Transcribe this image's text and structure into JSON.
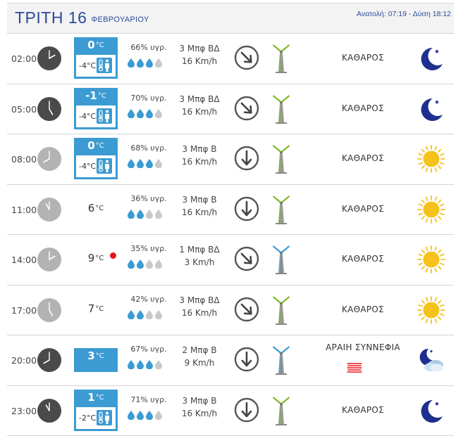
{
  "header": {
    "day": "ΤΡΙΤΗ 16",
    "month": "ΦΕΒΡΟΥΑΡΙΟΥ",
    "sun_times": "Ανατολή: 07:19 - Δύση 18:12"
  },
  "units": {
    "temp": "°C"
  },
  "rows": [
    {
      "time": "02:00",
      "clock_hour": 2,
      "clock_style": "dark",
      "temp": "0",
      "feel": "-4°C",
      "boxed": true,
      "humidity": "66% υγρ.",
      "drops": 3,
      "wind_force": "3 Μπφ ΒΔ",
      "wind_speed": "16 Km/h",
      "wind_dir": "nw",
      "turbine": "green",
      "condition": "ΚΑΘΑΡΟΣ",
      "icon": "moon-icon"
    },
    {
      "time": "05:00",
      "clock_hour": 5,
      "clock_style": "dark",
      "temp": "-1",
      "feel": "-4°C",
      "boxed": true,
      "humidity": "70% υγρ.",
      "drops": 3,
      "wind_force": "3 Μπφ ΒΔ",
      "wind_speed": "16 Km/h",
      "wind_dir": "nw",
      "turbine": "green",
      "condition": "ΚΑΘΑΡΟΣ",
      "icon": "moon-icon"
    },
    {
      "time": "08:00",
      "clock_hour": 8,
      "clock_style": "light",
      "temp": "0",
      "feel": "-4°C",
      "boxed": true,
      "humidity": "68% υγρ.",
      "drops": 3,
      "wind_force": "3 Μπφ Β",
      "wind_speed": "16 Km/h",
      "wind_dir": "n",
      "turbine": "green",
      "condition": "ΚΑΘΑΡΟΣ",
      "icon": "sun-icon"
    },
    {
      "time": "11:00",
      "clock_hour": 11,
      "clock_style": "light",
      "temp": "6",
      "feel": "",
      "boxed": false,
      "humidity": "36% υγρ.",
      "drops": 2,
      "wind_force": "3 Μπφ Β",
      "wind_speed": "16 Km/h",
      "wind_dir": "n",
      "turbine": "green",
      "condition": "ΚΑΘΑΡΟΣ",
      "icon": "sun-icon"
    },
    {
      "time": "14:00",
      "clock_hour": 2,
      "clock_style": "light",
      "temp": "9",
      "feel": "",
      "boxed": false,
      "red_dot": true,
      "humidity": "35% υγρ.",
      "drops": 2,
      "wind_force": "1 Μπφ ΒΔ",
      "wind_speed": "3 Km/h",
      "wind_dir": "nw",
      "turbine": "blue",
      "condition": "ΚΑΘΑΡΟΣ",
      "icon": "sun-icon"
    },
    {
      "time": "17:00",
      "clock_hour": 5,
      "clock_style": "light",
      "temp": "7",
      "feel": "",
      "boxed": false,
      "humidity": "42% υγρ.",
      "drops": 2,
      "wind_force": "3 Μπφ ΒΔ",
      "wind_speed": "16 Km/h",
      "wind_dir": "nw",
      "turbine": "green",
      "condition": "ΚΑΘΑΡΟΣ",
      "icon": "sun-icon"
    },
    {
      "time": "20:00",
      "clock_hour": 8,
      "clock_style": "dark",
      "temp": "3",
      "feel": "",
      "boxed": true,
      "single": true,
      "humidity": "67% υγρ.",
      "drops": 3,
      "wind_force": "2 Μπφ Β",
      "wind_speed": "9 Km/h",
      "wind_dir": "n",
      "turbine": "blue",
      "condition": "ΑΡΑΙΗ ΣΥΝΝΕΦΙΑ",
      "haze": true,
      "icon": "moon-cloud-icon"
    },
    {
      "time": "23:00",
      "clock_hour": 11,
      "clock_style": "dark",
      "temp": "1",
      "feel": "-2°C",
      "boxed": true,
      "humidity": "71% υγρ.",
      "drops": 3,
      "wind_force": "3 Μπφ Β",
      "wind_speed": "16 Km/h",
      "wind_dir": "n",
      "turbine": "green",
      "condition": "ΚΑΘΑΡΟΣ",
      "icon": "moon-icon"
    }
  ],
  "colors": {
    "accent": "#3b9bd2",
    "title": "#2c4a9b",
    "moon": "#1f2f8f",
    "sun": "#f5c21b",
    "drop_full": "#3b9bd2",
    "drop_empty": "#c9c9c9",
    "turbine_green": "#7dbb2c",
    "turbine_blue": "#3b9bd2",
    "clock_dark": "#4a4a4a",
    "clock_light": "#b3b3b3",
    "red_dot": "#e8141b"
  }
}
